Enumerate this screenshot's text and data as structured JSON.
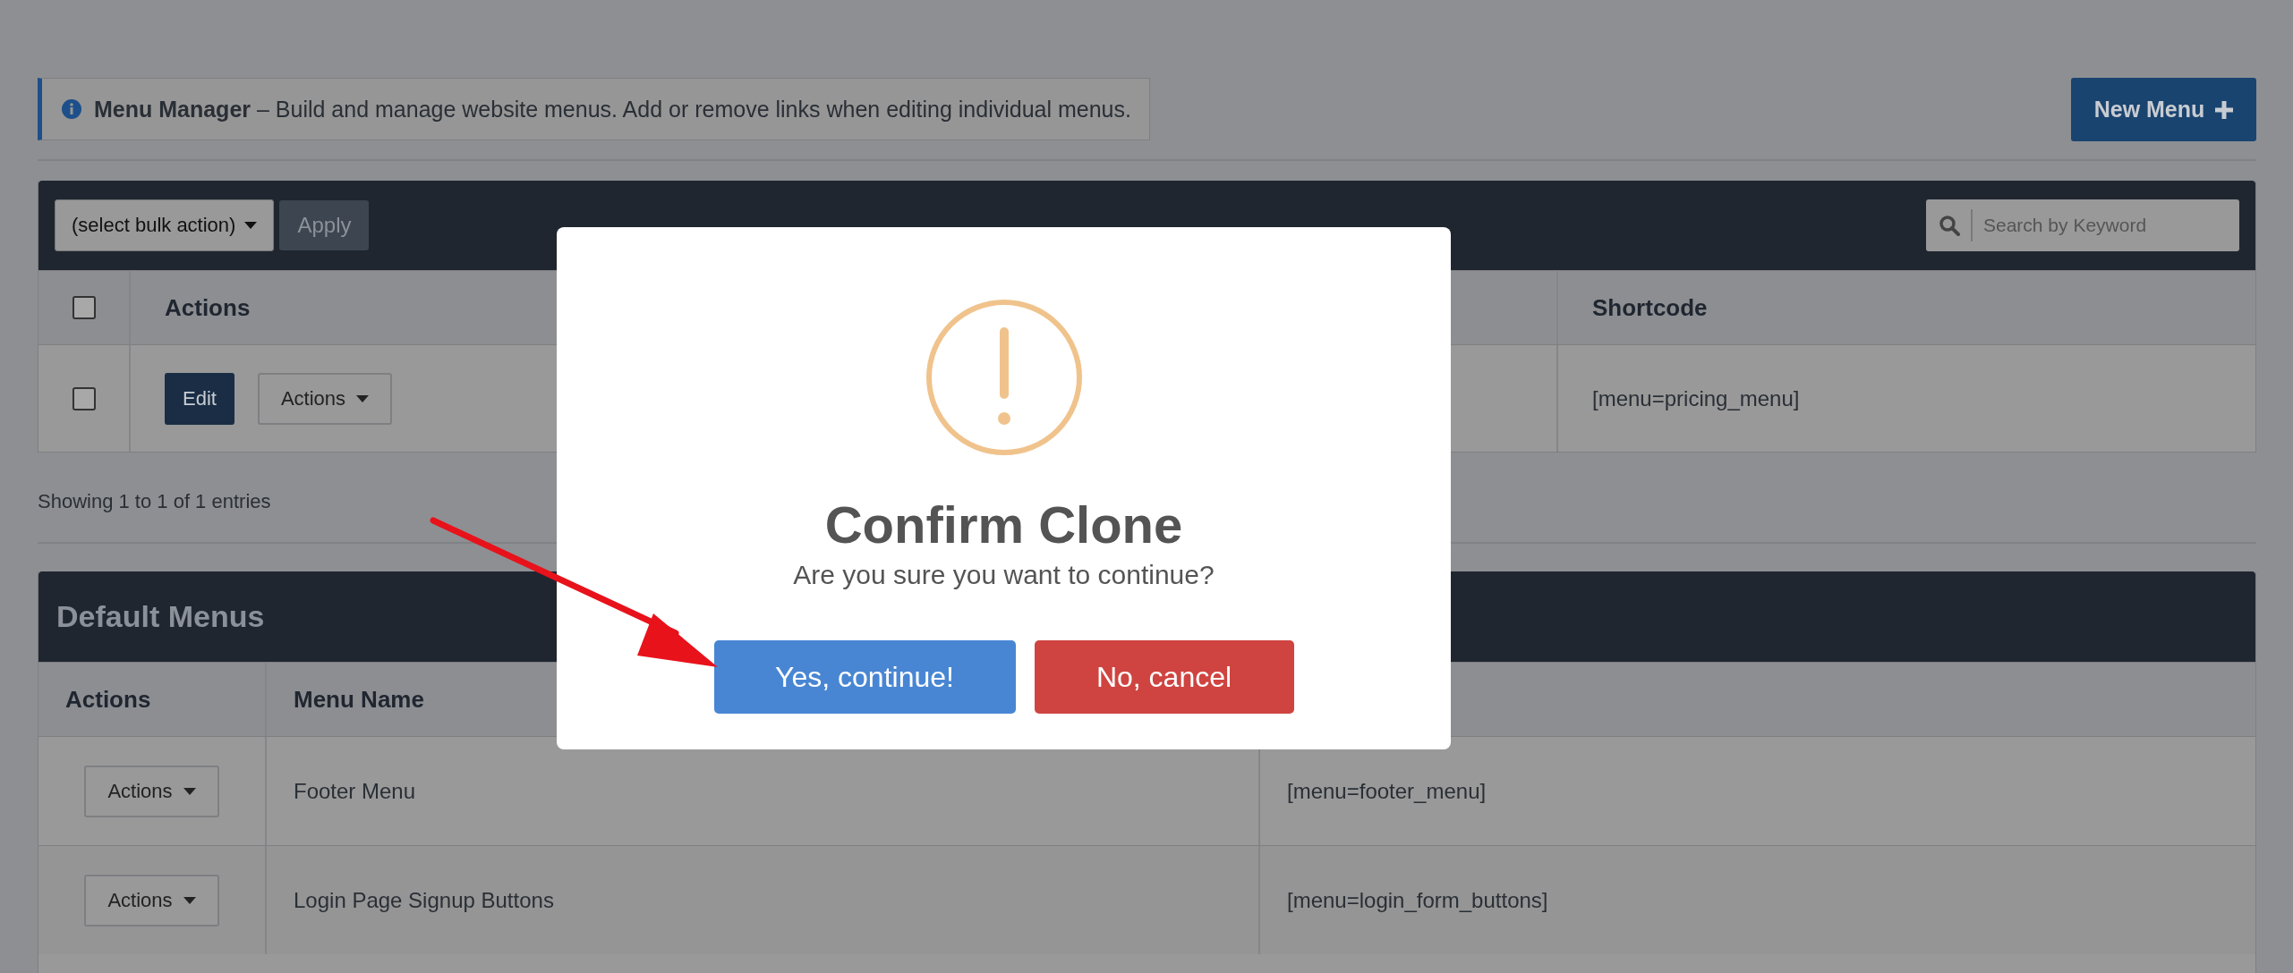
{
  "info": {
    "title": "Menu Manager",
    "text": "– Build and manage website menus. Add or remove links when editing individual menus."
  },
  "new_menu_button": "New Menu",
  "menus_table": {
    "bulk_action": "(select bulk action)",
    "apply": "Apply",
    "search": {
      "placeholder": "Search by Keyword"
    },
    "select_all_checked": false,
    "columns": [
      "Actions",
      "Shortcode"
    ],
    "rows": [
      {
        "checked": false,
        "edit": "Edit",
        "actions": "Actions",
        "shortcode": "[menu=pricing_menu]"
      }
    ]
  },
  "entries_info": "Showing 1 to 1 of 1 entries",
  "default_menus": {
    "title": "Default Menus",
    "columns": [
      "Actions",
      "Menu Name"
    ],
    "rows": [
      {
        "actions": "Actions",
        "name": "Footer Menu",
        "shortcode": "[menu=footer_menu]"
      },
      {
        "actions": "Actions",
        "name": "Login Page Signup Buttons",
        "shortcode": "[menu=login_form_buttons]"
      }
    ]
  },
  "dialog": {
    "title": "Confirm Clone",
    "message": "Are you sure you want to continue?",
    "buttons": [
      {
        "label": "Yes, continue!",
        "kind": "confirm"
      },
      {
        "label": "No, cancel",
        "kind": "cancel"
      }
    ]
  }
}
